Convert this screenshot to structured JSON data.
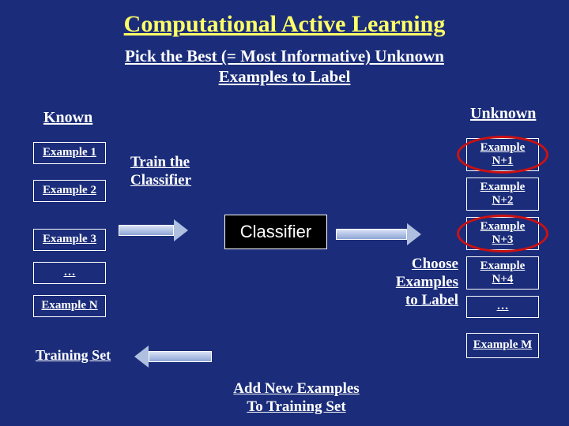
{
  "title": "Computational Active Learning",
  "subtitle_line1": "Pick the Best (= Most Informative) Unknown",
  "subtitle_line2": "Examples to Label",
  "known_heading": "Known",
  "unknown_heading": "Unknown",
  "known": {
    "e1": "Example 1",
    "e2": "Example 2",
    "e3": "Example 3",
    "dots": "…",
    "en": "Example N"
  },
  "unknown": {
    "e1a": "Example",
    "e1b": "N+1",
    "e2a": "Example",
    "e2b": "N+2",
    "e3a": "Example",
    "e3b": "N+3",
    "e4a": "Example",
    "e4b": "N+4",
    "dots": "…",
    "em": "Example M"
  },
  "train_line1": "Train the",
  "train_line2": "Classifier",
  "classifier": "Classifier",
  "choose_line1": "Choose ",
  "choose_line2": "Examples",
  "choose_line3": "to Label",
  "add_line1": "Add New Examples",
  "add_line2": "To Training Set",
  "training_set": "Training Set"
}
